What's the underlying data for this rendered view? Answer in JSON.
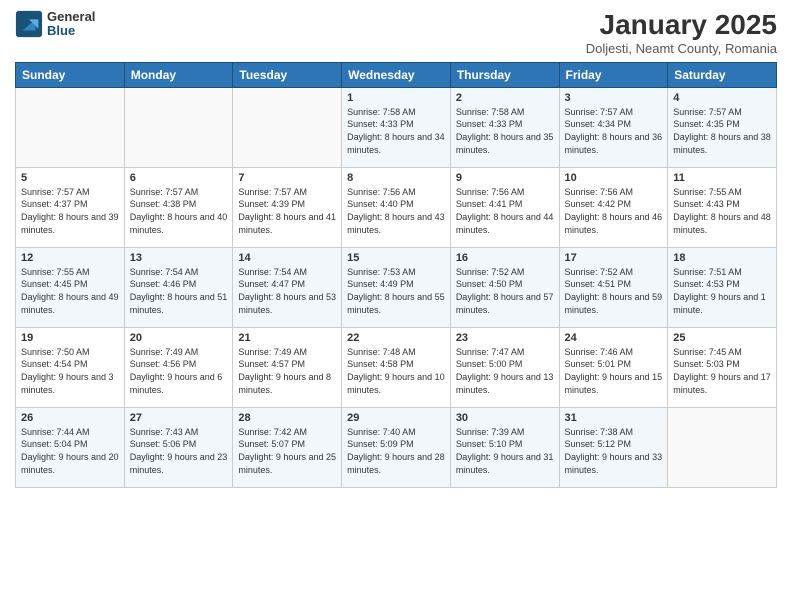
{
  "header": {
    "logo_general": "General",
    "logo_blue": "Blue",
    "month_title": "January 2025",
    "subtitle": "Doljesti, Neamt County, Romania"
  },
  "weekdays": [
    "Sunday",
    "Monday",
    "Tuesday",
    "Wednesday",
    "Thursday",
    "Friday",
    "Saturday"
  ],
  "weeks": [
    [
      {
        "day": "",
        "sunrise": "",
        "sunset": "",
        "daylight": ""
      },
      {
        "day": "",
        "sunrise": "",
        "sunset": "",
        "daylight": ""
      },
      {
        "day": "",
        "sunrise": "",
        "sunset": "",
        "daylight": ""
      },
      {
        "day": "1",
        "sunrise": "Sunrise: 7:58 AM",
        "sunset": "Sunset: 4:33 PM",
        "daylight": "Daylight: 8 hours and 34 minutes."
      },
      {
        "day": "2",
        "sunrise": "Sunrise: 7:58 AM",
        "sunset": "Sunset: 4:33 PM",
        "daylight": "Daylight: 8 hours and 35 minutes."
      },
      {
        "day": "3",
        "sunrise": "Sunrise: 7:57 AM",
        "sunset": "Sunset: 4:34 PM",
        "daylight": "Daylight: 8 hours and 36 minutes."
      },
      {
        "day": "4",
        "sunrise": "Sunrise: 7:57 AM",
        "sunset": "Sunset: 4:35 PM",
        "daylight": "Daylight: 8 hours and 38 minutes."
      }
    ],
    [
      {
        "day": "5",
        "sunrise": "Sunrise: 7:57 AM",
        "sunset": "Sunset: 4:37 PM",
        "daylight": "Daylight: 8 hours and 39 minutes."
      },
      {
        "day": "6",
        "sunrise": "Sunrise: 7:57 AM",
        "sunset": "Sunset: 4:38 PM",
        "daylight": "Daylight: 8 hours and 40 minutes."
      },
      {
        "day": "7",
        "sunrise": "Sunrise: 7:57 AM",
        "sunset": "Sunset: 4:39 PM",
        "daylight": "Daylight: 8 hours and 41 minutes."
      },
      {
        "day": "8",
        "sunrise": "Sunrise: 7:56 AM",
        "sunset": "Sunset: 4:40 PM",
        "daylight": "Daylight: 8 hours and 43 minutes."
      },
      {
        "day": "9",
        "sunrise": "Sunrise: 7:56 AM",
        "sunset": "Sunset: 4:41 PM",
        "daylight": "Daylight: 8 hours and 44 minutes."
      },
      {
        "day": "10",
        "sunrise": "Sunrise: 7:56 AM",
        "sunset": "Sunset: 4:42 PM",
        "daylight": "Daylight: 8 hours and 46 minutes."
      },
      {
        "day": "11",
        "sunrise": "Sunrise: 7:55 AM",
        "sunset": "Sunset: 4:43 PM",
        "daylight": "Daylight: 8 hours and 48 minutes."
      }
    ],
    [
      {
        "day": "12",
        "sunrise": "Sunrise: 7:55 AM",
        "sunset": "Sunset: 4:45 PM",
        "daylight": "Daylight: 8 hours and 49 minutes."
      },
      {
        "day": "13",
        "sunrise": "Sunrise: 7:54 AM",
        "sunset": "Sunset: 4:46 PM",
        "daylight": "Daylight: 8 hours and 51 minutes."
      },
      {
        "day": "14",
        "sunrise": "Sunrise: 7:54 AM",
        "sunset": "Sunset: 4:47 PM",
        "daylight": "Daylight: 8 hours and 53 minutes."
      },
      {
        "day": "15",
        "sunrise": "Sunrise: 7:53 AM",
        "sunset": "Sunset: 4:49 PM",
        "daylight": "Daylight: 8 hours and 55 minutes."
      },
      {
        "day": "16",
        "sunrise": "Sunrise: 7:52 AM",
        "sunset": "Sunset: 4:50 PM",
        "daylight": "Daylight: 8 hours and 57 minutes."
      },
      {
        "day": "17",
        "sunrise": "Sunrise: 7:52 AM",
        "sunset": "Sunset: 4:51 PM",
        "daylight": "Daylight: 8 hours and 59 minutes."
      },
      {
        "day": "18",
        "sunrise": "Sunrise: 7:51 AM",
        "sunset": "Sunset: 4:53 PM",
        "daylight": "Daylight: 9 hours and 1 minute."
      }
    ],
    [
      {
        "day": "19",
        "sunrise": "Sunrise: 7:50 AM",
        "sunset": "Sunset: 4:54 PM",
        "daylight": "Daylight: 9 hours and 3 minutes."
      },
      {
        "day": "20",
        "sunrise": "Sunrise: 7:49 AM",
        "sunset": "Sunset: 4:56 PM",
        "daylight": "Daylight: 9 hours and 6 minutes."
      },
      {
        "day": "21",
        "sunrise": "Sunrise: 7:49 AM",
        "sunset": "Sunset: 4:57 PM",
        "daylight": "Daylight: 9 hours and 8 minutes."
      },
      {
        "day": "22",
        "sunrise": "Sunrise: 7:48 AM",
        "sunset": "Sunset: 4:58 PM",
        "daylight": "Daylight: 9 hours and 10 minutes."
      },
      {
        "day": "23",
        "sunrise": "Sunrise: 7:47 AM",
        "sunset": "Sunset: 5:00 PM",
        "daylight": "Daylight: 9 hours and 13 minutes."
      },
      {
        "day": "24",
        "sunrise": "Sunrise: 7:46 AM",
        "sunset": "Sunset: 5:01 PM",
        "daylight": "Daylight: 9 hours and 15 minutes."
      },
      {
        "day": "25",
        "sunrise": "Sunrise: 7:45 AM",
        "sunset": "Sunset: 5:03 PM",
        "daylight": "Daylight: 9 hours and 17 minutes."
      }
    ],
    [
      {
        "day": "26",
        "sunrise": "Sunrise: 7:44 AM",
        "sunset": "Sunset: 5:04 PM",
        "daylight": "Daylight: 9 hours and 20 minutes."
      },
      {
        "day": "27",
        "sunrise": "Sunrise: 7:43 AM",
        "sunset": "Sunset: 5:06 PM",
        "daylight": "Daylight: 9 hours and 23 minutes."
      },
      {
        "day": "28",
        "sunrise": "Sunrise: 7:42 AM",
        "sunset": "Sunset: 5:07 PM",
        "daylight": "Daylight: 9 hours and 25 minutes."
      },
      {
        "day": "29",
        "sunrise": "Sunrise: 7:40 AM",
        "sunset": "Sunset: 5:09 PM",
        "daylight": "Daylight: 9 hours and 28 minutes."
      },
      {
        "day": "30",
        "sunrise": "Sunrise: 7:39 AM",
        "sunset": "Sunset: 5:10 PM",
        "daylight": "Daylight: 9 hours and 31 minutes."
      },
      {
        "day": "31",
        "sunrise": "Sunrise: 7:38 AM",
        "sunset": "Sunset: 5:12 PM",
        "daylight": "Daylight: 9 hours and 33 minutes."
      },
      {
        "day": "",
        "sunrise": "",
        "sunset": "",
        "daylight": ""
      }
    ]
  ]
}
